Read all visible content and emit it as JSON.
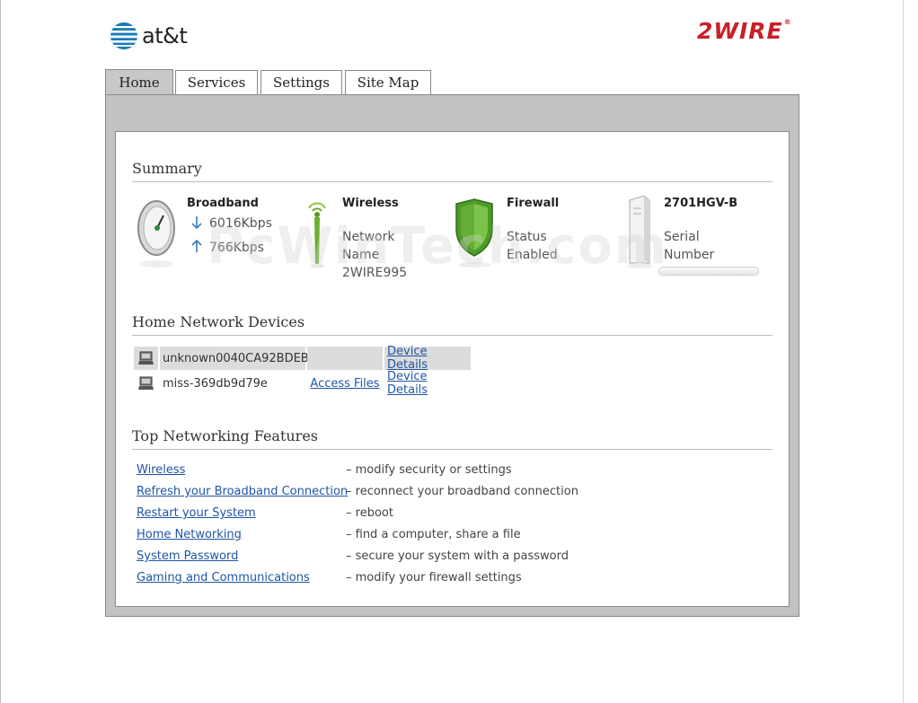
{
  "header": {
    "att_logo_text": "at&t",
    "twowire_logo_text": "2WIRE",
    "twowire_reg": "®"
  },
  "tabs": [
    {
      "label": "Home",
      "active": true
    },
    {
      "label": "Services",
      "active": false
    },
    {
      "label": "Settings",
      "active": false
    },
    {
      "label": "Site Map",
      "active": false
    }
  ],
  "summary": {
    "title": "Summary",
    "broadband": {
      "title": "Broadband",
      "down": "6016Kbps",
      "up": "766Kbps"
    },
    "wireless": {
      "title": "Wireless",
      "line1": "Network",
      "line2": "Name",
      "line3": "2WIRE995"
    },
    "firewall": {
      "title": "Firewall",
      "line1": "Status",
      "line2": "Enabled"
    },
    "device": {
      "title": "2701HGV-B",
      "line1": "Serial",
      "line2": "Number"
    }
  },
  "home_network": {
    "title": "Home Network Devices",
    "devices": [
      {
        "name": "unknown0040CA92BDEB",
        "access": "",
        "details": "Device Details"
      },
      {
        "name": "miss-369db9d79e",
        "access": "Access Files",
        "details": "Device Details"
      }
    ]
  },
  "features": {
    "title": "Top Networking Features",
    "items": [
      {
        "link": "Wireless",
        "desc": "– modify security or settings"
      },
      {
        "link": "Refresh your Broadband Connection",
        "desc": "– reconnect your broadband connection"
      },
      {
        "link": "Restart your System",
        "desc": "– reboot"
      },
      {
        "link": "Home Networking",
        "desc": "– find a computer, share a file"
      },
      {
        "link": "System Password",
        "desc": "– secure your system with a password"
      },
      {
        "link": "Gaming and Communications",
        "desc": "– modify your firewall settings"
      }
    ]
  },
  "watermark": "PcWinTech.com",
  "colors": {
    "link": "#1f55a5",
    "brand_red": "#c8202a",
    "panel_grey": "#c2c2c2"
  }
}
